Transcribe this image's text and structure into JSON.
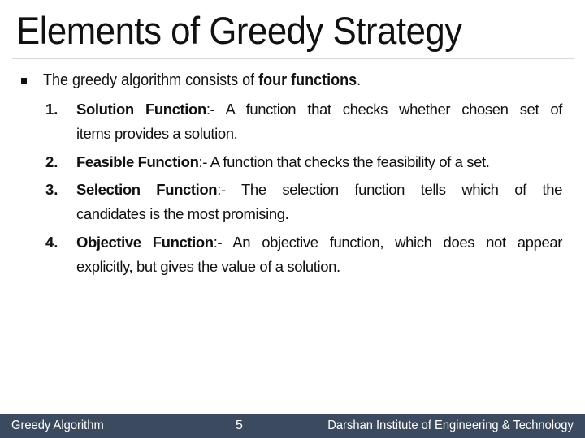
{
  "slide": {
    "title": "Elements of Greedy Strategy",
    "intro": {
      "prefix": "The greedy algorithm consists of ",
      "bold": "four functions",
      "suffix": "."
    },
    "items": [
      {
        "number": "1.",
        "term": "Solution Function",
        "separator": ":- ",
        "line1": "A function that checks whether chosen set of",
        "line2": "items provides a solution."
      },
      {
        "number": "2.",
        "term": "Feasible Function",
        "separator": ":- ",
        "line1": "A function that checks the feasibility of a set.",
        "line2": ""
      },
      {
        "number": "3.",
        "term": "Selection Function",
        "separator": ":- ",
        "line1": "The selection function tells which of the",
        "line2": "candidates is the most promising."
      },
      {
        "number": "4.",
        "term": "Objective Function",
        "separator": ":- ",
        "line1": "An objective function, which does not appear",
        "line2": "explicitly, but gives the value of a solution."
      }
    ]
  },
  "footer": {
    "left": "Greedy Algorithm",
    "page_number": "5",
    "right": "Darshan Institute of Engineering & Technology",
    "background": "#3b4a5e"
  }
}
